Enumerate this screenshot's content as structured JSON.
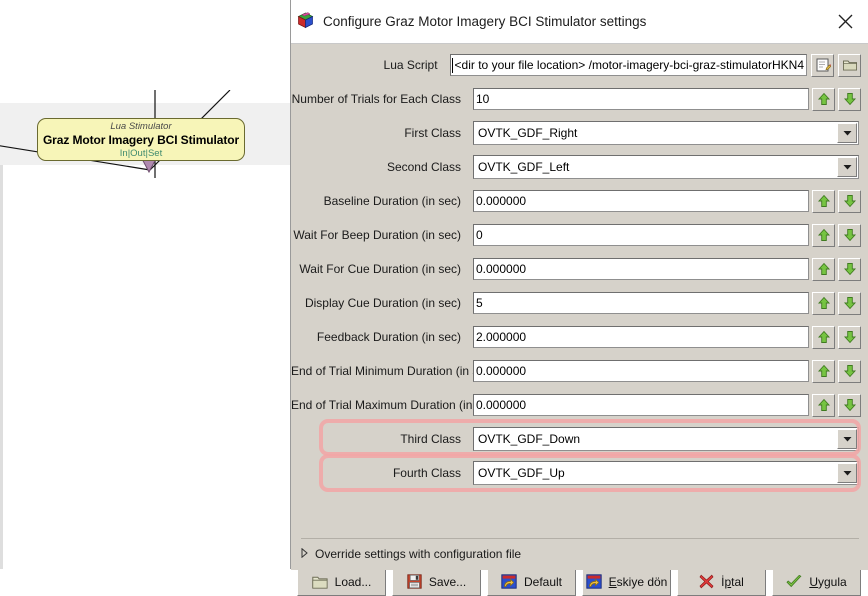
{
  "canvas": {
    "box": {
      "subtitle": "Lua Stimulator",
      "title": "Graz Motor Imagery BCI Stimulator",
      "ports": "In|Out|Set",
      "fill_color": "#f7f5b8",
      "border_color": "#6a6a30",
      "ports_color": "#3f8a6e"
    }
  },
  "dialog": {
    "title": "Configure Graz Motor Imagery BCI Stimulator settings",
    "app_icon": "openvibe-cube-icon",
    "close_icon": "close-icon",
    "rows": [
      {
        "label": "Lua Script",
        "type": "text-with-buttons",
        "value": "<dir to your file location> /motor-imagery-bci-graz-stimulatorHKN4",
        "caret": true,
        "buttons": [
          "edit-icon",
          "folder-icon"
        ]
      },
      {
        "label": "Number of Trials for Each Class",
        "type": "spinner",
        "value": "10"
      },
      {
        "label": "First Class",
        "type": "combo",
        "value": "OVTK_GDF_Right"
      },
      {
        "label": "Second Class",
        "type": "combo",
        "value": "OVTK_GDF_Left"
      },
      {
        "label": "Baseline Duration (in sec)",
        "type": "spinner",
        "value": "0.000000"
      },
      {
        "label": "Wait For Beep Duration (in sec)",
        "type": "spinner",
        "value": "0"
      },
      {
        "label": "Wait For Cue Duration (in sec)",
        "type": "spinner",
        "value": "0.000000"
      },
      {
        "label": "Display Cue Duration (in sec)",
        "type": "spinner",
        "value": "5"
      },
      {
        "label": "Feedback Duration (in sec)",
        "type": "spinner",
        "value": "2.000000"
      },
      {
        "label": "End of Trial Minimum Duration (in sec)",
        "type": "spinner",
        "value": "0.000000"
      },
      {
        "label": "End of Trial Maximum Duration (in sec)",
        "type": "spinner",
        "value": "0.000000"
      },
      {
        "label": "Third Class",
        "type": "combo",
        "value": "OVTK_GDF_Down",
        "highlighted": true
      },
      {
        "label": "Fourth Class",
        "type": "combo",
        "value": "OVTK_GDF_Up",
        "highlighted": true
      }
    ],
    "override": {
      "label": "Override settings with configuration file",
      "expander_icon": "triangle-right-icon",
      "expanded": false
    },
    "buttons": [
      {
        "label": "Load...",
        "icon": "folder-open-icon",
        "mnemonic": ""
      },
      {
        "label": "Save...",
        "icon": "floppy-disk-icon",
        "mnemonic": ""
      },
      {
        "label": "Default",
        "icon": "revert-icon",
        "mnemonic": ""
      },
      {
        "label": "Eskiye dön",
        "icon": "undo-icon",
        "mnemonic": "E"
      },
      {
        "label": "İptal",
        "icon": "red-x-icon",
        "mnemonic": "p"
      },
      {
        "label": "Uygula",
        "icon": "green-check-icon",
        "mnemonic": "U"
      }
    ],
    "highlight_color": "#f2a6a6"
  }
}
